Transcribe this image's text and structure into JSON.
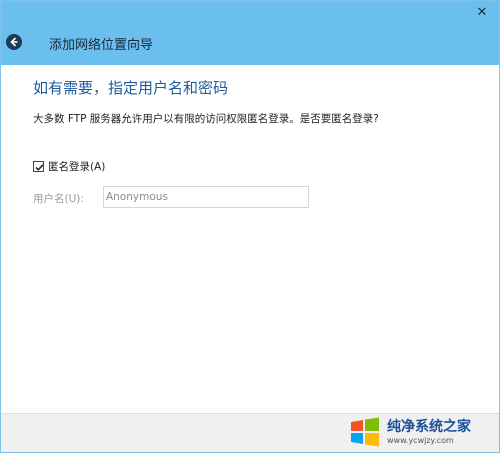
{
  "window": {
    "close_glyph": "✕"
  },
  "header": {
    "wizard_title": "添加网络位置向导"
  },
  "main": {
    "heading": "如有需要，指定用户名和密码",
    "description": "大多数 FTP 服务器允许用户以有限的访问权限匿名登录。是否要匿名登录?",
    "anonymous_checkbox": {
      "label": "匿名登录(A)",
      "checked": true
    },
    "username": {
      "label": "用户名(U):",
      "value": "Anonymous",
      "enabled": false
    }
  },
  "watermark": {
    "title": "纯净系统之家",
    "url": "www.ycwjzy.com"
  },
  "colors": {
    "titlebar": "#6bbfef",
    "heading": "#1e5a9e",
    "footer": "#f0f0f0"
  }
}
